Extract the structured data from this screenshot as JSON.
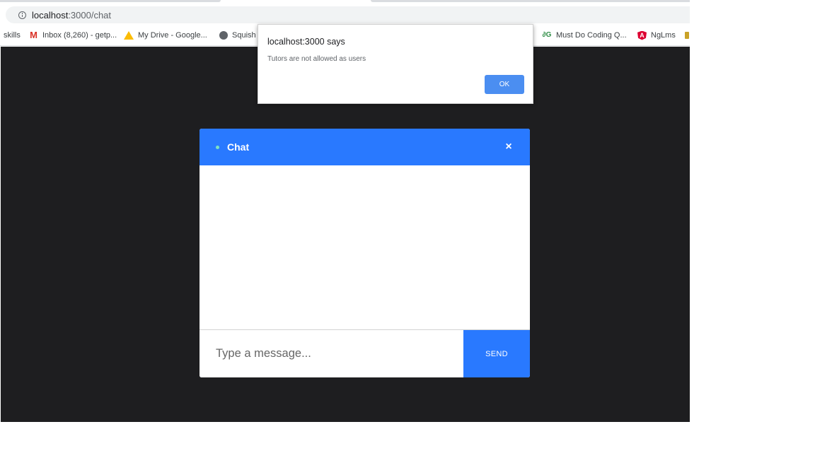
{
  "browser": {
    "url_host": "localhost",
    "url_rest": ":3000/chat",
    "bookmarks": [
      {
        "label": "skills",
        "icon": "bookmark-text"
      },
      {
        "label": "Inbox (8,260) - getp...",
        "icon": "gmail-icon",
        "glyph": "M"
      },
      {
        "label": "My Drive - Google...",
        "icon": "google-drive-icon",
        "glyph": ""
      },
      {
        "label": "Squish",
        "icon": "globe-icon",
        "glyph": "◉"
      },
      {
        "label": "Must Do Coding Q...",
        "icon": "geeksforgeeks-icon",
        "glyph": "∂G"
      },
      {
        "label": "NgLms",
        "icon": "angular-icon",
        "glyph": "A"
      }
    ]
  },
  "alert": {
    "title": "localhost:3000 says",
    "message": "Tutors are not allowed as users",
    "ok_label": "OK"
  },
  "chat": {
    "title": "Chat",
    "close_glyph": "×",
    "input_placeholder": "Type a message...",
    "send_label": "SEND",
    "colors": {
      "header": "#2979ff",
      "status_dot": "#7ee2c2",
      "page_background": "#1e1e20"
    }
  }
}
